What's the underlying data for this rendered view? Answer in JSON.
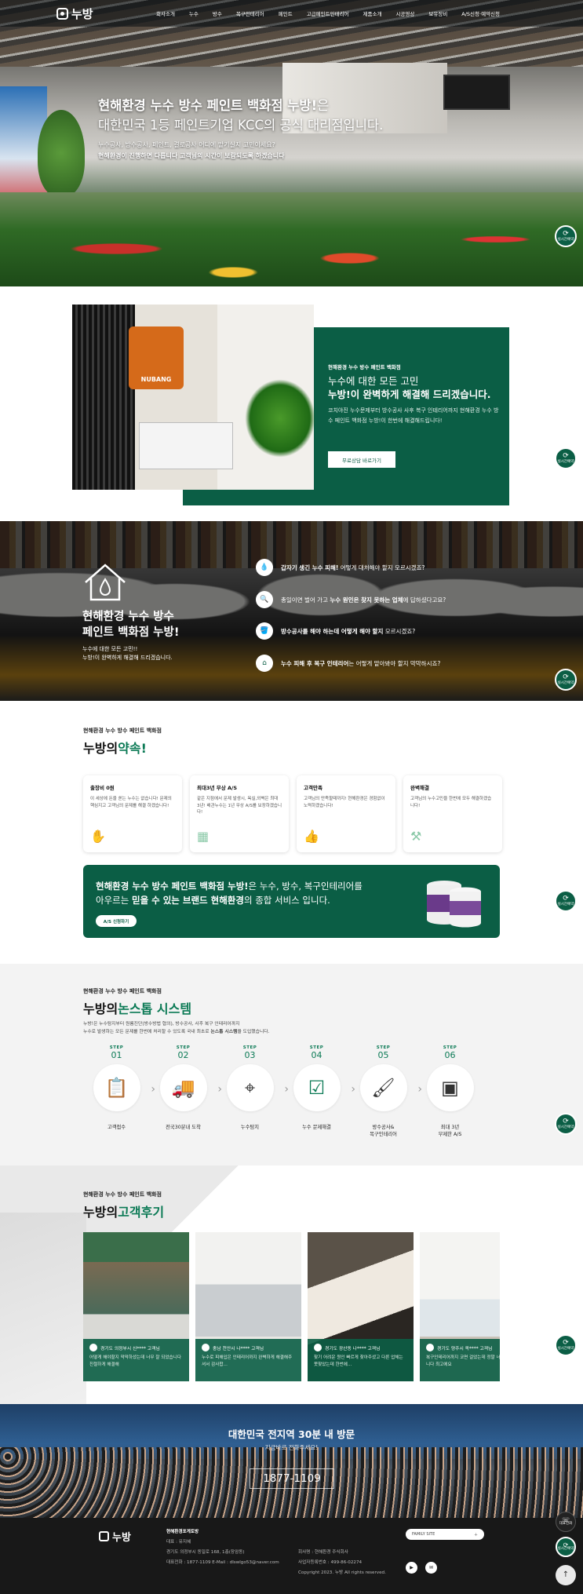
{
  "header": {
    "logo": "누방",
    "nav": [
      "회사소개",
      "누수",
      "방수",
      "복구인테리어",
      "페인트",
      "고급페인트인테리어",
      "제품소개",
      "시공영상",
      "보유장비",
      "A/S신청·예약신청"
    ]
  },
  "hero": {
    "line1_bold": "현해환경 누수 방수 페인트 백화점 누방!",
    "line1_rest": "은",
    "line2": "대한민국 1등 페인트기업 KCC의 공식 대리점입니다.",
    "sub1": "누수공사, 방수공사, 페인트, 결로공사 어디에 맡기실지 고민이세요?",
    "sub2": "현해환경이 진행하면 다릅니다 고객님의 시간이 보람되도록 하겠습니다"
  },
  "quick_button": {
    "label": "실시간예약"
  },
  "intro": {
    "kicker": "현해환경 누수 방수 페인트 백화점",
    "title1": "누수에 대한 모든 고민",
    "title2": "누방!이 완벽하게 해결해 드리겠습니다.",
    "desc": "코치야진 누수문제부터 방수공사 사후 복구 인테리어까지 현해환경 누수 방수 페인트 백화점 누방!이 한번에 해결해드립니다!",
    "button": "무료상담 바로가기",
    "sign": "NUBANG"
  },
  "problems": {
    "title1": "현해환경 누수 방수",
    "title2": "페인트 백화점 누방!",
    "small1": "누수에 대한 모든 고민!!",
    "small2": "누방!이 완벽하게 해결해 드리겠습니다.",
    "items": [
      {
        "bold": "갑자기 생긴 누수 피해!",
        "rest": " 어떻게 대처해야 할지 모르시겠죠?",
        "lead": "",
        "icon": "drip-icon"
      },
      {
        "lead": "총일이면 벌어 가고 ",
        "bold": "누수 원인은 찾지 못하는 업체",
        "rest": "에 답하셨다고요?",
        "icon": "search-icon"
      },
      {
        "bold": "방수공사를 해야 하는데 어떻게 해야 할지",
        "rest": " 모르시겠죠?",
        "lead": "",
        "icon": "bucket-icon"
      },
      {
        "bold": "누수 피해 후 복구 인테리어",
        "rest": "는 어떻게 맡아봐야 할지 막막하시죠?",
        "lead": "",
        "icon": "house-icon"
      }
    ]
  },
  "promise": {
    "kicker": "현해환경 누수 방수 페인트 백화점",
    "title": "누방의",
    "title_accent": "약속!",
    "cards": [
      {
        "title": "출장비 0원",
        "desc": "이 세상에 돈을 쏟는 누수는 없습니다! 문제의 핵심지고 고객님의 문제를 해결 하겠습니다!"
      },
      {
        "title": "최대3년 무상 A/S",
        "desc": "같은 지점에서 문제 발생시, 욕실,외벽은 최대 3년! 배관누수는 1년 무상 A/S를 보장하겠습니다!"
      },
      {
        "title": "고객만족",
        "desc": "고객님의 만족할때까지! 현해환경은 경험없이 노력하겠습니다!"
      },
      {
        "title": "완벽해결",
        "desc": "고객님의 누수고민을 한번에 모두 해결하겠습니다!"
      }
    ],
    "banner_bold1": "현해환경 누수 방수 페인트 백화점 누방!",
    "banner_text1": "은 누수, 방수, 복구인테리어를",
    "banner_text2": "아우르는 ",
    "banner_bold2": "믿을 수 있는 브랜드 현해환경",
    "banner_text3": "의 종합 서비스 입니다.",
    "banner_button": "A/S 신청하기"
  },
  "system": {
    "kicker": "현해환경 누수 방수 페인트 백화점",
    "title": "누방의",
    "title_accent": "논스톱 시스템",
    "desc1": "누방!은 누수탐지부터 원룸진단(방수방법 협의), 방수공사, 사후 복구 인테리어까지",
    "desc2_pre": "누수로 발생하는 모든 문제를 한번에 처리할 수 있도록 국내 최초로 ",
    "desc2_bold": "논스톱 시스템",
    "desc2_post": "을 도입했습니다.",
    "step_word": "STEP",
    "steps": [
      {
        "num": "01",
        "label": "고객접수",
        "icon": "clipboard-icon"
      },
      {
        "num": "02",
        "label": "전국30분내 도착",
        "icon": "truck-icon"
      },
      {
        "num": "03",
        "label": "누수탐지",
        "icon": "tripod-icon"
      },
      {
        "num": "04",
        "label": "누수 문제해결",
        "icon": "check-clipboard-icon"
      },
      {
        "num": "05",
        "label": "방수공사&\n복구인테리어",
        "icon": "roller-icon"
      },
      {
        "num": "06",
        "label": "최대 3년\n무제한 A/S",
        "icon": "certificate-icon"
      }
    ]
  },
  "reviews": {
    "kicker": "현해환경 누수 방수 페인트 백화점",
    "title": "누방의",
    "title_accent": "고객후기",
    "items": [
      {
        "who": "경기도 의정부시 신**** 고객님",
        "text": "어떻게 해야할지 막막하셨는데 너무 잘 되었습니다 친절하게 해결해"
      },
      {
        "who": "충남 천안시 나**** 고객님",
        "text": "누수로 피해입은 인테리어까지 완벽하게 해결해주셔서 감사합..."
      },
      {
        "who": "경기도 광산동 나**** 고객님",
        "text": "찾기 어려운 원인 빠르게 찾아주셨고 다른 업체는 못찾았는데 한번에..."
      },
      {
        "who": "경기도 양주시 옥**** 고객님",
        "text": "복구인테리어까지 코면 걸었는데 정말 너무 만족합니다 최고에요"
      }
    ]
  },
  "visit": {
    "title": "대한민국 전지역 30분 내 방문",
    "sub": "지금바로 전화주세요!",
    "phone": "1877-1109"
  },
  "footer": {
    "logo": "누방",
    "company_title": "현해환경포게토방",
    "addr1_label": "대표",
    "addr1": "대표 : 유지혜",
    "addr2": "경기도 의정부시 동일로 168, 1층(장암동)",
    "contact": "대표전화 : 1877-1109    E-Mail : dlswlgo53@naver.com",
    "biz1": "회사명 : 현해환경 주식회사",
    "biz2": "사업자등록번호 : 499-86-02274",
    "copyright": "Copyright 2023. 누방 All rights reserved.",
    "family_site": "FAMILY SITE",
    "side1": "대표전화",
    "side2": "실시간예약",
    "top": "↑"
  },
  "colors": {
    "brand_green": "#0b5e45",
    "accent_green": "#0b7a55"
  }
}
